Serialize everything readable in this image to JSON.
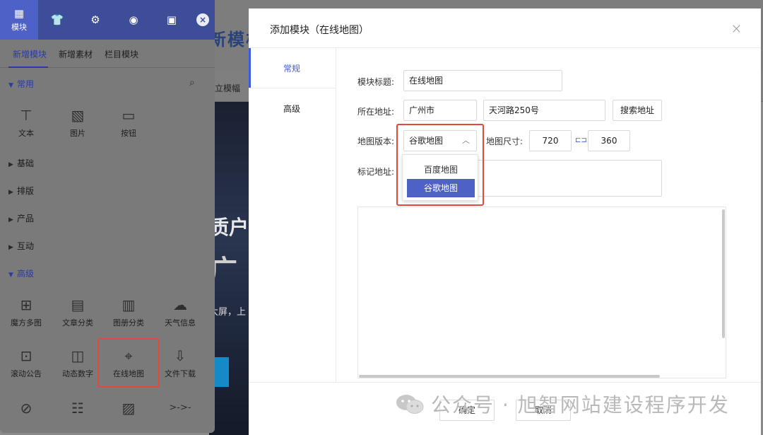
{
  "background": {
    "site_title": "新模板",
    "nav_text": "立模幅",
    "hero_line1": "质户",
    "hero_line2": "广",
    "hero_line3": "大屏，上"
  },
  "panel": {
    "tabs": [
      {
        "icon": "grid-icon",
        "label": "模块"
      },
      {
        "icon": "shirt-icon",
        "label": ""
      },
      {
        "icon": "gear-icon",
        "label": ""
      },
      {
        "icon": "chrome-icon",
        "label": ""
      },
      {
        "icon": "robot-icon",
        "label": ""
      }
    ],
    "close": "×",
    "subtabs": [
      "新增模块",
      "新增素材",
      "栏目模块"
    ],
    "cat_common": "常用",
    "common_items": [
      "文本",
      "图片",
      "按钮"
    ],
    "cat_basic": "基础",
    "cat_layout": "排版",
    "cat_product": "产品",
    "cat_interactive": "互动",
    "cat_advanced": "高级",
    "advanced_items": [
      "魔方多图",
      "文章分类",
      "图册分类",
      "天气信息",
      "滚动公告",
      "动态数字",
      "在线地图",
      "文件下载"
    ]
  },
  "dialog": {
    "title": "添加模块（在线地图）",
    "close": "×",
    "nav": [
      "常规",
      "高级"
    ],
    "form": {
      "title_label": "模块标题:",
      "title_value": "在线地图",
      "address_label": "所在地址:",
      "city_value": "广州市",
      "street_value": "天河路250号",
      "search_button": "搜索地址",
      "version_label": "地图版本:",
      "version_value": "谷歌地图",
      "size_label": "地图尺寸:",
      "width_value": "720",
      "height_value": "360",
      "marker_label": "标记地址:"
    },
    "dropdown_options": [
      "百度地图",
      "谷歌地图"
    ],
    "dropdown_selected": "谷歌地图",
    "footer": {
      "confirm": "确定",
      "cancel": "取消"
    }
  },
  "watermark": "公众号 · 旭智网站建设程序开发",
  "colors": {
    "panel_header": "#3d4d97",
    "accent": "#4e61c7",
    "highlight": "#e04a3c"
  }
}
